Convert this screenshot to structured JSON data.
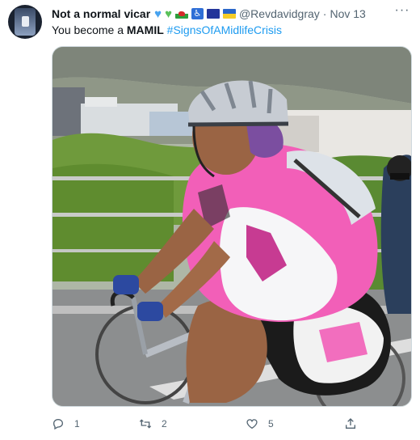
{
  "author": {
    "display_name": "Not a normal vicar",
    "handle": "@Revdavidgray",
    "separator": "·",
    "date": "Nov 13",
    "emojis": [
      "blue-heart-icon",
      "green-heart-icon",
      "wales-flag-icon",
      "wheelchair-icon",
      "eu-flag-icon",
      "ukraine-flag-icon"
    ]
  },
  "more_label": "···",
  "tweet": {
    "text_before": "You become a ",
    "text_bold": "MAMIL",
    "hashtag": "#SignsOfAMidlifeCrisis"
  },
  "media": {
    "icon": "photo-cyclist-pink-jersey"
  },
  "actions": {
    "reply_count": "1",
    "retweet_count": "2",
    "like_count": "5"
  },
  "colors": {
    "link": "#1d9bf0",
    "muted": "#536471",
    "jersey_pink": "#f25fb8"
  }
}
